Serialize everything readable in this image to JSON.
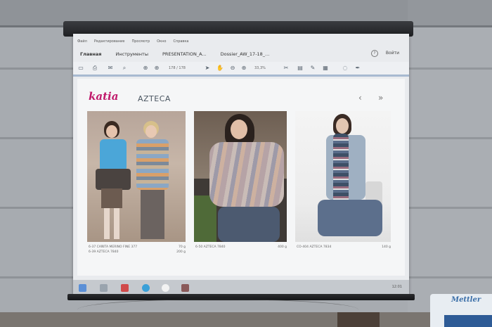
{
  "app": {
    "menu": [
      "Файл",
      "Редактирование",
      "Просмотр",
      "Окно",
      "Справка"
    ],
    "tabs": [
      {
        "label": "Главная"
      },
      {
        "label": "Инструменты"
      },
      {
        "label": "PRESENTATION_A..."
      },
      {
        "label": "Dossier_AW_17-18_..."
      }
    ],
    "signin": "Войти",
    "help": "?",
    "page_indicator": "178 / 178",
    "zoom": "33,3%"
  },
  "document": {
    "logo": "katia",
    "title": "AZTECA",
    "nav_prev": "‹",
    "nav_next": "»",
    "captions": [
      {
        "left": "6-37 CAÑITA MERINO FINE 377\n6-39 AZTECA 7840",
        "right": "70 g\n200 g"
      },
      {
        "left": "6-50 AZTECA 7840",
        "right": "400 g"
      },
      {
        "left": "CO-404 AZTECA 7834",
        "right": "140 g"
      }
    ]
  },
  "taskbar": {
    "clock": "12:01"
  },
  "room": {
    "sign_text": "Mettler"
  },
  "colors": {
    "brand": "#c0186a",
    "screen": "#e9ebee",
    "sign_blue": "#2e5b96"
  }
}
